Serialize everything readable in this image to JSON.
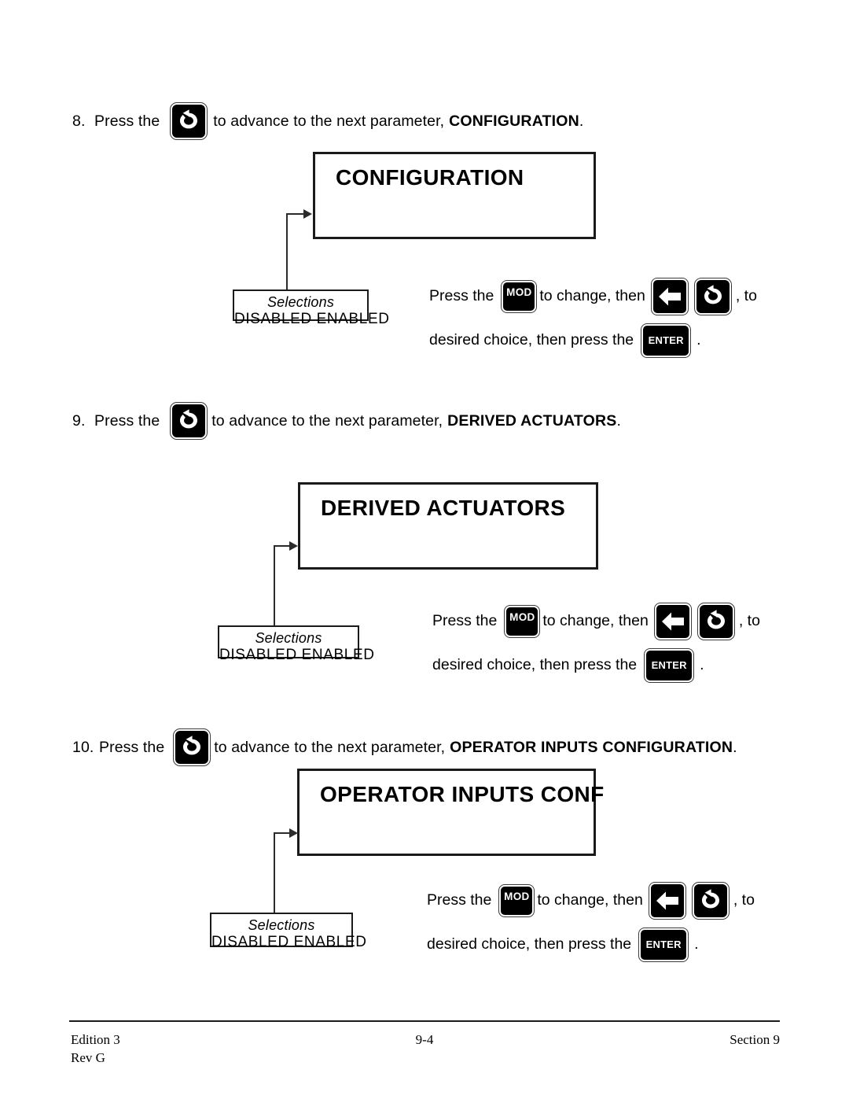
{
  "document": {
    "page_number": "9-4",
    "edition": "Edition 3",
    "revision": "Rev G",
    "section": "Section 9"
  },
  "icons": {
    "advance": "advance-loop-arrow-icon",
    "mod": "mod-key-icon",
    "left": "left-arrow-key-icon",
    "enter": "enter-key-icon"
  },
  "keys": {
    "mod_label": "MOD",
    "enter_label": "ENTER"
  },
  "selections": {
    "title": "Selections",
    "options": "DISABLED    ENABLED",
    "option_list": [
      "DISABLED",
      "ENABLED"
    ]
  },
  "instruction": {
    "line1_a": "Press the",
    "line1_b": "to change, then",
    "line1_c": ", to",
    "line2_a": "desired choice, then press the",
    "line2_b": "."
  },
  "blocks": [
    {
      "step_number": "8.",
      "step_pre": "Press the",
      "step_post": "to advance to the next parameter,",
      "parameter_name": "CONFIGURATION",
      "step_end": ".",
      "display_title": "CONFIGURATION"
    },
    {
      "step_number": "9.",
      "step_pre": "Press the",
      "step_post": "to advance to the next parameter,",
      "parameter_name": "DERIVED ACTUATORS",
      "step_end": ".",
      "display_title": "DERIVED ACTUATORS"
    },
    {
      "step_number": "10.",
      "step_pre": "Press the",
      "step_post": "to advance to the next parameter,",
      "parameter_name": "OPERATOR INPUTS CONFIGURATION",
      "step_end": ".",
      "display_title": "OPERATOR INPUTS CONF"
    }
  ]
}
